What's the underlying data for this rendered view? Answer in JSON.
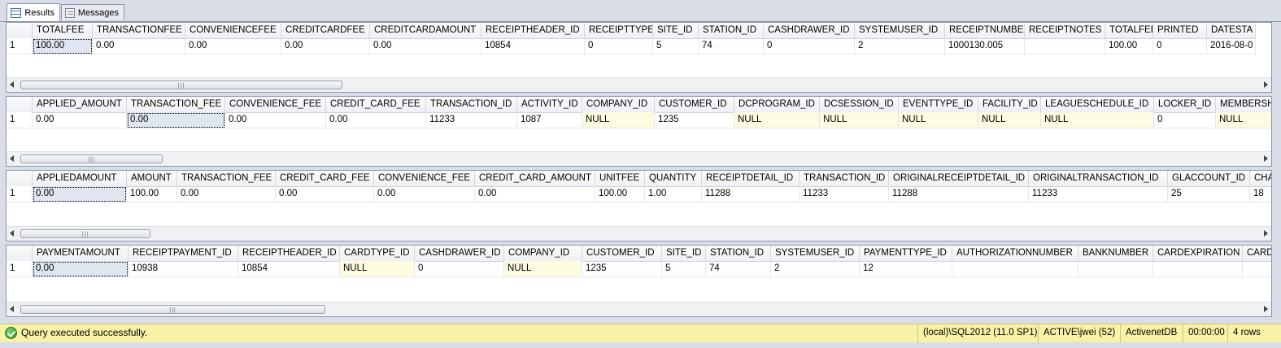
{
  "tabs": [
    {
      "label": "Results",
      "icon": "results-grid-icon",
      "active": true
    },
    {
      "label": "Messages",
      "icon": "messages-icon",
      "active": false
    }
  ],
  "grids": [
    {
      "columns": [
        "TOTALFEE",
        "TRANSACTIONFEE",
        "CONVENIENCEFEE",
        "CREDITCARDFEE",
        "CREDITCARDAMOUNT",
        "RECEIPTHEADER_ID",
        "RECEIPTTYPE",
        "SITE_ID",
        "STATION_ID",
        "CASHDRAWER_ID",
        "SYSTEMUSER_ID",
        "RECEIPTNUMBER",
        "RECEIPTNOTES",
        "TOTALFEE",
        "PRINTED",
        "DATESTA"
      ],
      "rows": [
        {
          "num": "1",
          "cells": [
            "100.00",
            "0.00",
            "0.00",
            "0.00",
            "0.00",
            "10854",
            "0",
            "5",
            "74",
            "0",
            "2",
            "1000130.005",
            "",
            "100.00",
            "0",
            "2016-08-0"
          ]
        }
      ]
    },
    {
      "columns": [
        "APPLIED_AMOUNT",
        "TRANSACTION_FEE",
        "CONVENIENCE_FEE",
        "CREDIT_CARD_FEE",
        "TRANSACTION_ID",
        "ACTIVITY_ID",
        "COMPANY_ID",
        "CUSTOMER_ID",
        "DCPROGRAM_ID",
        "DCSESSION_ID",
        "EVENTTYPE_ID",
        "FACILITY_ID",
        "LEAGUESCHEDULE_ID",
        "LOCKER_ID",
        "MEMBERSHI"
      ],
      "rows": [
        {
          "num": "1",
          "cells": [
            "0.00",
            "0.00",
            "0.00",
            "0.00",
            "11233",
            "1087",
            "NULL",
            "1235",
            "NULL",
            "NULL",
            "NULL",
            "NULL",
            "NULL",
            "0",
            "NULL"
          ]
        }
      ]
    },
    {
      "columns": [
        "APPLIEDAMOUNT",
        "AMOUNT",
        "TRANSACTION_FEE",
        "CREDIT_CARD_FEE",
        "CONVENIENCE_FEE",
        "CREDIT_CARD_AMOUNT",
        "UNITFEE",
        "QUANTITY",
        "RECEIPTDETAIL_ID",
        "TRANSACTION_ID",
        "ORIGINALRECEIPTDETAIL_ID",
        "ORIGINALTRANSACTION_ID",
        "GLACCOUNT_ID",
        "CHAR"
      ],
      "rows": [
        {
          "num": "1",
          "cells": [
            "0.00",
            "100.00",
            "0.00",
            "0.00",
            "0.00",
            "0.00",
            "100.00",
            "1.00",
            "11288",
            "11233",
            "11288",
            "11233",
            "25",
            "18"
          ]
        }
      ]
    },
    {
      "columns": [
        "PAYMENTAMOUNT",
        "RECEIPTPAYMENT_ID",
        "RECEIPTHEADER_ID",
        "CARDTYPE_ID",
        "CASHDRAWER_ID",
        "COMPANY_ID",
        "CUSTOMER_ID",
        "SITE_ID",
        "STATION_ID",
        "SYSTEMUSER_ID",
        "PAYMENTTYPE_ID",
        "AUTHORIZATIONNUMBER",
        "BANKNUMBER",
        "CARDEXPIRATION",
        "CARDN"
      ],
      "rows": [
        {
          "num": "1",
          "cells": [
            "0.00",
            "10938",
            "10854",
            "NULL",
            "0",
            "NULL",
            "1235",
            "5",
            "74",
            "2",
            "12",
            "",
            "",
            "",
            ""
          ]
        }
      ]
    }
  ],
  "status": {
    "message": "Query executed successfully.",
    "server": "(local)\\SQL2012 (11.0 SP1)",
    "user": "ACTIVE\\jwei (52)",
    "database": "ActivenetDB",
    "elapsed": "00:00:00",
    "rows": "4 rows",
    "bar_color": "#f9f2a6"
  }
}
